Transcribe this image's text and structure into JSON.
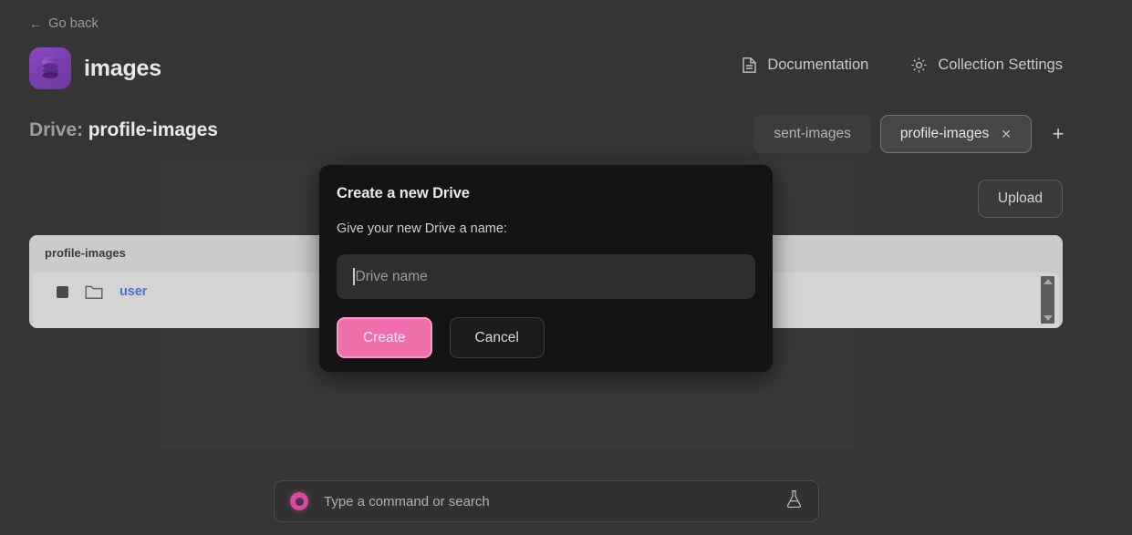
{
  "nav": {
    "back_label": "Go back",
    "back_arrow": "←"
  },
  "header": {
    "brand_name": "images",
    "logo_icon": "database-stack-icon",
    "links": [
      {
        "label": "Documentation",
        "icon": "document-icon"
      },
      {
        "label": "Collection Settings",
        "icon": "gear-icon"
      }
    ]
  },
  "drive": {
    "title_label": "Drive:",
    "title_value": "profile-images",
    "tabs": [
      {
        "label": "sent-images",
        "active": false,
        "closable": false
      },
      {
        "label": "profile-images",
        "active": true,
        "closable": true,
        "close_glyph": "✕"
      }
    ],
    "add_tab_glyph": "+",
    "upload_label": "Upload"
  },
  "file_panel": {
    "header": "profile-images",
    "rows": [
      {
        "name": "user",
        "type": "folder",
        "icon": "folder-icon",
        "checkbox_checked": true
      }
    ],
    "scrollbar": {
      "up_glyph": "▲",
      "down_glyph": "▼"
    }
  },
  "modal": {
    "title": "Create a new Drive",
    "subtitle": "Give your new Drive a name:",
    "input_placeholder": "Drive name",
    "input_value": "",
    "create_label": "Create",
    "cancel_label": "Cancel"
  },
  "command_bar": {
    "placeholder": "Type a command or search",
    "value": "",
    "left_icon": "status-dot-icon",
    "right_icon": "flask-icon"
  },
  "colors": {
    "page_bg": "#353535",
    "accent_pink": "#ef6fad",
    "accent_pink_border": "#f79ac9",
    "logo_purple": "#7b3fb0",
    "panel_light": "#cbcbcb",
    "link_blue": "#4a6fd0",
    "modal_bg": "#141414",
    "dot_magenta": "#d94a9e"
  }
}
